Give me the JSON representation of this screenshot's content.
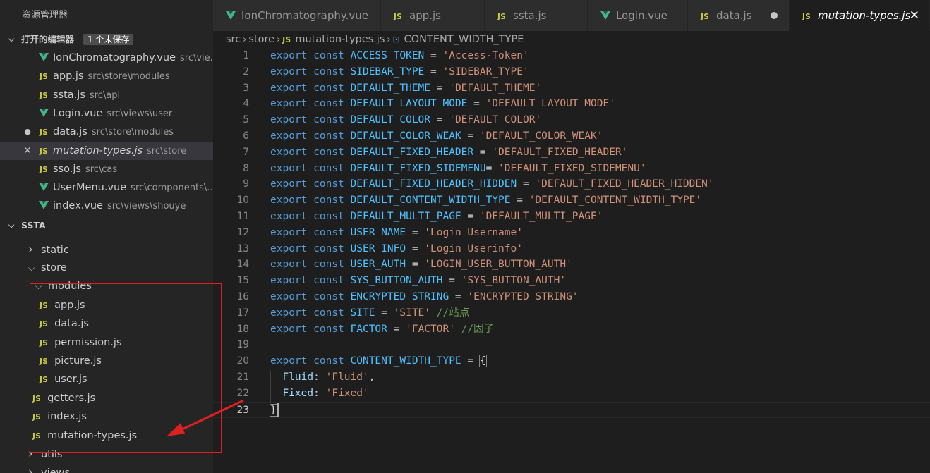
{
  "sidebar": {
    "title": "资源管理器",
    "open_editors": {
      "label": "打开的编辑器",
      "badge": "1 个未保存",
      "items": [
        {
          "name": "IonChromatography.vue",
          "path": "src\\vie...",
          "type": "vue",
          "state": ""
        },
        {
          "name": "app.js",
          "path": "src\\store\\modules",
          "type": "js",
          "state": ""
        },
        {
          "name": "ssta.js",
          "path": "src\\api",
          "type": "js",
          "state": ""
        },
        {
          "name": "Login.vue",
          "path": "src\\views\\user",
          "type": "vue",
          "state": ""
        },
        {
          "name": "data.js",
          "path": "src\\store\\modules",
          "type": "js",
          "state": "dirty"
        },
        {
          "name": "mutation-types.js",
          "path": "src\\store",
          "type": "js",
          "state": "active"
        },
        {
          "name": "sso.js",
          "path": "src\\cas",
          "type": "js",
          "state": ""
        },
        {
          "name": "UserMenu.vue",
          "path": "src\\components\\...",
          "type": "vue",
          "state": ""
        },
        {
          "name": "index.vue",
          "path": "src\\views\\shouye",
          "type": "vue",
          "state": ""
        }
      ]
    },
    "workspace": {
      "label": "SSTA",
      "tree": [
        {
          "kind": "folder",
          "name": "static",
          "open": false
        },
        {
          "kind": "folder",
          "name": "store",
          "open": true
        },
        {
          "kind": "folder",
          "name": "modules",
          "open": true
        },
        {
          "kind": "file",
          "name": "app.js"
        },
        {
          "kind": "file",
          "name": "data.js"
        },
        {
          "kind": "file",
          "name": "permission.js"
        },
        {
          "kind": "file",
          "name": "picture.js"
        },
        {
          "kind": "file",
          "name": "user.js"
        },
        {
          "kind": "file",
          "name": "getters.js"
        },
        {
          "kind": "file",
          "name": "index.js"
        },
        {
          "kind": "file",
          "name": "mutation-types.js"
        },
        {
          "kind": "folder",
          "name": "utils",
          "open": false
        },
        {
          "kind": "folder",
          "name": "views",
          "open": false
        }
      ]
    }
  },
  "tabs": [
    {
      "label": "IonChromatography.vue",
      "type": "vue",
      "state": ""
    },
    {
      "label": "app.js",
      "type": "js",
      "state": ""
    },
    {
      "label": "ssta.js",
      "type": "js",
      "state": ""
    },
    {
      "label": "Login.vue",
      "type": "vue",
      "state": ""
    },
    {
      "label": "data.js",
      "type": "js",
      "state": "dirty"
    },
    {
      "label": "mutation-types.js",
      "type": "js",
      "state": "active"
    }
  ],
  "breadcrumb": [
    "src",
    "store",
    "mutation-types.js",
    "CONTENT_WIDTH_TYPE"
  ],
  "code_lines": [
    [
      [
        "kw",
        "export"
      ],
      [
        "op",
        " "
      ],
      [
        "kw",
        "const"
      ],
      [
        "op",
        " "
      ],
      [
        "cn",
        "ACCESS_TOKEN"
      ],
      [
        "op",
        " = "
      ],
      [
        "st",
        "'Access-Token'"
      ]
    ],
    [
      [
        "kw",
        "export"
      ],
      [
        "op",
        " "
      ],
      [
        "kw",
        "const"
      ],
      [
        "op",
        " "
      ],
      [
        "cn",
        "SIDEBAR_TYPE"
      ],
      [
        "op",
        " = "
      ],
      [
        "st",
        "'SIDEBAR_TYPE'"
      ]
    ],
    [
      [
        "kw",
        "export"
      ],
      [
        "op",
        " "
      ],
      [
        "kw",
        "const"
      ],
      [
        "op",
        " "
      ],
      [
        "cn",
        "DEFAULT_THEME"
      ],
      [
        "op",
        " = "
      ],
      [
        "st",
        "'DEFAULT_THEME'"
      ]
    ],
    [
      [
        "kw",
        "export"
      ],
      [
        "op",
        " "
      ],
      [
        "kw",
        "const"
      ],
      [
        "op",
        " "
      ],
      [
        "cn",
        "DEFAULT_LAYOUT_MODE"
      ],
      [
        "op",
        " = "
      ],
      [
        "st",
        "'DEFAULT_LAYOUT_MODE'"
      ]
    ],
    [
      [
        "kw",
        "export"
      ],
      [
        "op",
        " "
      ],
      [
        "kw",
        "const"
      ],
      [
        "op",
        " "
      ],
      [
        "cn",
        "DEFAULT_COLOR"
      ],
      [
        "op",
        " = "
      ],
      [
        "st",
        "'DEFAULT_COLOR'"
      ]
    ],
    [
      [
        "kw",
        "export"
      ],
      [
        "op",
        " "
      ],
      [
        "kw",
        "const"
      ],
      [
        "op",
        " "
      ],
      [
        "cn",
        "DEFAULT_COLOR_WEAK"
      ],
      [
        "op",
        " = "
      ],
      [
        "st",
        "'DEFAULT_COLOR_WEAK'"
      ]
    ],
    [
      [
        "kw",
        "export"
      ],
      [
        "op",
        " "
      ],
      [
        "kw",
        "const"
      ],
      [
        "op",
        " "
      ],
      [
        "cn",
        "DEFAULT_FIXED_HEADER"
      ],
      [
        "op",
        " = "
      ],
      [
        "st",
        "'DEFAULT_FIXED_HEADER'"
      ]
    ],
    [
      [
        "kw",
        "export"
      ],
      [
        "op",
        " "
      ],
      [
        "kw",
        "const"
      ],
      [
        "op",
        " "
      ],
      [
        "cn",
        "DEFAULT_FIXED_SIDEMENU"
      ],
      [
        "op",
        "= "
      ],
      [
        "st",
        "'DEFAULT_FIXED_SIDEMENU'"
      ]
    ],
    [
      [
        "kw",
        "export"
      ],
      [
        "op",
        " "
      ],
      [
        "kw",
        "const"
      ],
      [
        "op",
        " "
      ],
      [
        "cn",
        "DEFAULT_FIXED_HEADER_HIDDEN"
      ],
      [
        "op",
        " = "
      ],
      [
        "st",
        "'DEFAULT_FIXED_HEADER_HIDDEN'"
      ]
    ],
    [
      [
        "kw",
        "export"
      ],
      [
        "op",
        " "
      ],
      [
        "kw",
        "const"
      ],
      [
        "op",
        " "
      ],
      [
        "cn",
        "DEFAULT_CONTENT_WIDTH_TYPE"
      ],
      [
        "op",
        " = "
      ],
      [
        "st",
        "'DEFAULT_CONTENT_WIDTH_TYPE'"
      ]
    ],
    [
      [
        "kw",
        "export"
      ],
      [
        "op",
        " "
      ],
      [
        "kw",
        "const"
      ],
      [
        "op",
        " "
      ],
      [
        "cn",
        "DEFAULT_MULTI_PAGE"
      ],
      [
        "op",
        " = "
      ],
      [
        "st",
        "'DEFAULT_MULTI_PAGE'"
      ]
    ],
    [
      [
        "kw",
        "export"
      ],
      [
        "op",
        " "
      ],
      [
        "kw",
        "const"
      ],
      [
        "op",
        " "
      ],
      [
        "cn",
        "USER_NAME"
      ],
      [
        "op",
        " = "
      ],
      [
        "st",
        "'Login_Username'"
      ]
    ],
    [
      [
        "kw",
        "export"
      ],
      [
        "op",
        " "
      ],
      [
        "kw",
        "const"
      ],
      [
        "op",
        " "
      ],
      [
        "cn",
        "USER_INFO"
      ],
      [
        "op",
        " = "
      ],
      [
        "st",
        "'Login_Userinfo'"
      ]
    ],
    [
      [
        "kw",
        "export"
      ],
      [
        "op",
        " "
      ],
      [
        "kw",
        "const"
      ],
      [
        "op",
        " "
      ],
      [
        "cn",
        "USER_AUTH"
      ],
      [
        "op",
        " = "
      ],
      [
        "st",
        "'LOGIN_USER_BUTTON_AUTH'"
      ]
    ],
    [
      [
        "kw",
        "export"
      ],
      [
        "op",
        " "
      ],
      [
        "kw",
        "const"
      ],
      [
        "op",
        " "
      ],
      [
        "cn",
        "SYS_BUTTON_AUTH"
      ],
      [
        "op",
        " = "
      ],
      [
        "st",
        "'SYS_BUTTON_AUTH'"
      ]
    ],
    [
      [
        "kw",
        "export"
      ],
      [
        "op",
        " "
      ],
      [
        "kw",
        "const"
      ],
      [
        "op",
        " "
      ],
      [
        "cn",
        "ENCRYPTED_STRING"
      ],
      [
        "op",
        " = "
      ],
      [
        "st",
        "'ENCRYPTED_STRING'"
      ]
    ],
    [
      [
        "kw",
        "export"
      ],
      [
        "op",
        " "
      ],
      [
        "kw",
        "const"
      ],
      [
        "op",
        " "
      ],
      [
        "cn",
        "SITE"
      ],
      [
        "op",
        " = "
      ],
      [
        "st",
        "'SITE'"
      ],
      [
        "op",
        " "
      ],
      [
        "cm",
        "//站点"
      ]
    ],
    [
      [
        "kw",
        "export"
      ],
      [
        "op",
        " "
      ],
      [
        "kw",
        "const"
      ],
      [
        "op",
        " "
      ],
      [
        "cn",
        "FACTOR"
      ],
      [
        "op",
        " = "
      ],
      [
        "st",
        "'FACTOR'"
      ],
      [
        "op",
        " "
      ],
      [
        "cm",
        "//因子"
      ]
    ],
    [],
    [
      [
        "kw",
        "export"
      ],
      [
        "op",
        " "
      ],
      [
        "kw",
        "const"
      ],
      [
        "op",
        " "
      ],
      [
        "cn",
        "CONTENT_WIDTH_TYPE"
      ],
      [
        "op",
        " = "
      ],
      [
        "br",
        "{"
      ]
    ],
    [
      [
        "op",
        "  "
      ],
      [
        "pr",
        "Fluid"
      ],
      [
        "op",
        ": "
      ],
      [
        "st",
        "'Fluid'"
      ],
      [
        "op",
        ","
      ]
    ],
    [
      [
        "op",
        "  "
      ],
      [
        "pr",
        "Fixed"
      ],
      [
        "op",
        ": "
      ],
      [
        "st",
        "'Fixed'"
      ]
    ],
    [
      [
        "br",
        "}"
      ]
    ]
  ],
  "current_line": 23
}
